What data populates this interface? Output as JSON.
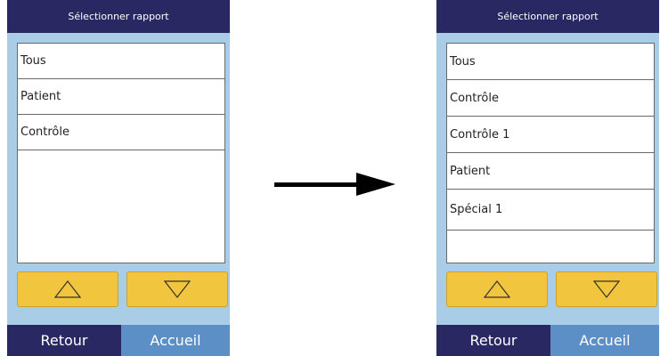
{
  "left_screen": {
    "title": "Sélectionner rapport",
    "items": [
      "Tous",
      "Patient",
      "Contrôle"
    ],
    "back_label": "Retour",
    "home_label": "Accueil"
  },
  "right_screen": {
    "title": "Sélectionner rapport",
    "items": [
      "Tous",
      "Contrôle",
      "Contrôle 1",
      "Patient",
      "Spécial 1"
    ],
    "back_label": "Retour",
    "home_label": "Accueil"
  },
  "icons": {
    "up": "triangle-up-icon",
    "down": "triangle-down-icon",
    "transition": "right-arrow-icon"
  },
  "colors": {
    "titlebar": "#2a2862",
    "background": "#a9cde6",
    "button": "#f2c53f",
    "home": "#5b8fc6"
  }
}
